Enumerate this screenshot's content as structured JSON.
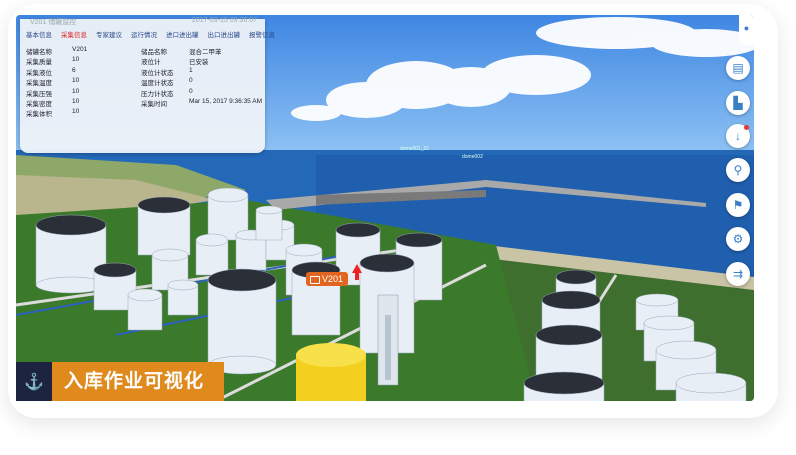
{
  "panel": {
    "title": "V201 储罐监控",
    "time": "2017-03-15 09:36:07",
    "tabs": [
      "基本信息",
      "采集信息",
      "专家建议",
      "运行情况",
      "进口进出罐",
      "出口进出罐",
      "报警信息"
    ],
    "active_tab": 1,
    "rows": [
      {
        "k1": "储罐名称",
        "v1": "V201",
        "k2": "储品名称",
        "v2": "混合二甲苯"
      },
      {
        "k1": "采集质量",
        "v1": "10",
        "k2": "液位计",
        "v2": "已安装"
      },
      {
        "k1": "采集液位",
        "v1": "6",
        "k2": "液位计状态",
        "v2": "1"
      },
      {
        "k1": "采集温度",
        "v1": "10",
        "k2": "温度计状态",
        "v2": "0"
      },
      {
        "k1": "采集压强",
        "v1": "10",
        "k2": "压力计状态",
        "v2": "0"
      },
      {
        "k1": "采集密度",
        "v1": "10",
        "k2": "采集时间",
        "v2": "Mar 15, 2017 9:36:35 AM"
      },
      {
        "k1": "采集体积",
        "v1": "10",
        "k2": "",
        "v2": ""
      }
    ]
  },
  "scene": {
    "tank_tag": "V201",
    "pier_labels": [
      "dome001_01",
      "dome002"
    ]
  },
  "footer": {
    "title": "入库作业可视化"
  },
  "toolbar": {
    "icons": [
      "user-icon",
      "tank-icon",
      "factory-icon",
      "anchor-icon",
      "search-icon",
      "flag-icon",
      "settings-icon",
      "exit-icon"
    ]
  }
}
